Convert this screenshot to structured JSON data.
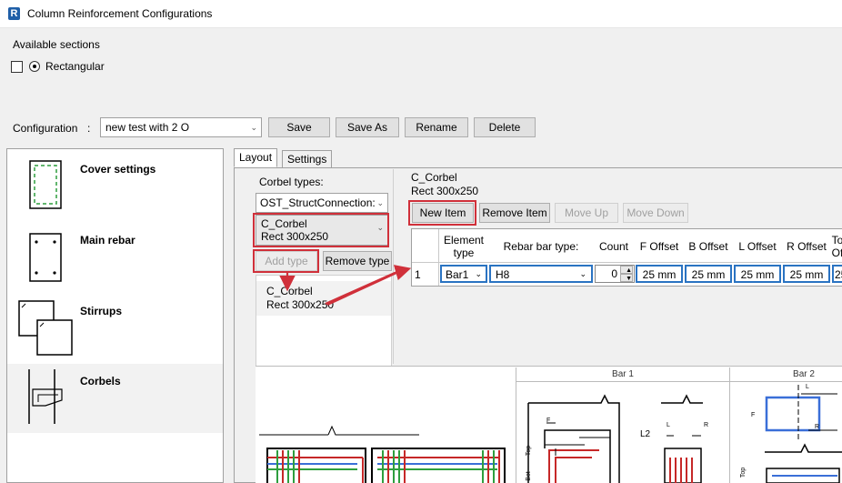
{
  "window": {
    "title": "Column Reinforcement Configurations",
    "app_icon_letter": "R"
  },
  "sections": {
    "heading": "Available sections",
    "option_label": "Rectangular"
  },
  "config": {
    "label": "Configuration",
    "separator": ":",
    "selected": "new test with 2 O",
    "buttons": {
      "save": "Save",
      "save_as": "Save As",
      "rename": "Rename",
      "delete": "Delete"
    }
  },
  "sidebar": {
    "items": [
      {
        "label": "Cover settings",
        "icon": "cover-settings-icon"
      },
      {
        "label": "Main rebar",
        "icon": "main-rebar-icon"
      },
      {
        "label": "Stirrups",
        "icon": "stirrups-icon"
      },
      {
        "label": "Corbels",
        "icon": "corbels-icon"
      }
    ]
  },
  "tabs": {
    "layout": "Layout",
    "settings": "Settings"
  },
  "corbel": {
    "types_label": "Corbel types:",
    "family_selected": "OST_StructConnection:",
    "type_line1": "C_Corbel",
    "type_line2": "Rect 300x250",
    "add_type": "Add type",
    "remove_type": "Remove type",
    "list_item_line1": "C_Corbel",
    "list_item_line2": "Rect 300x250",
    "header_line1": "C_Corbel",
    "header_line2": "Rect 300x250"
  },
  "items": {
    "new_item": "New Item",
    "remove_item": "Remove Item",
    "move_up": "Move Up",
    "move_down": "Move Down"
  },
  "grid": {
    "columns": [
      "Element type",
      "Rebar bar type:",
      "Count",
      "F Offset",
      "B Offset",
      "L Offset",
      "R Offset",
      "To Of"
    ],
    "rows": [
      {
        "index": "1",
        "element_type": "Bar1",
        "bar_type": "H8",
        "count": "0",
        "f_offset": "25 mm",
        "b_offset": "25 mm",
        "l_offset": "25 mm",
        "r_offset": "25 mm",
        "top_offset": "25"
      }
    ]
  },
  "preview": {
    "bar1_label": "Bar 1",
    "bar2_label": "Bar 2",
    "dim_f": "F",
    "dim_l2": "L2",
    "dim_l": "L",
    "dim_r": "R",
    "dim_top": "Top",
    "dim_bot": "Bot",
    "dim_f2": "F",
    "dim_l_b2": "L",
    "dim_r_b2": "R",
    "dim_top_b2": "Top"
  },
  "colors": {
    "highlight": "#d0303a",
    "accent": "#2a73c2"
  }
}
